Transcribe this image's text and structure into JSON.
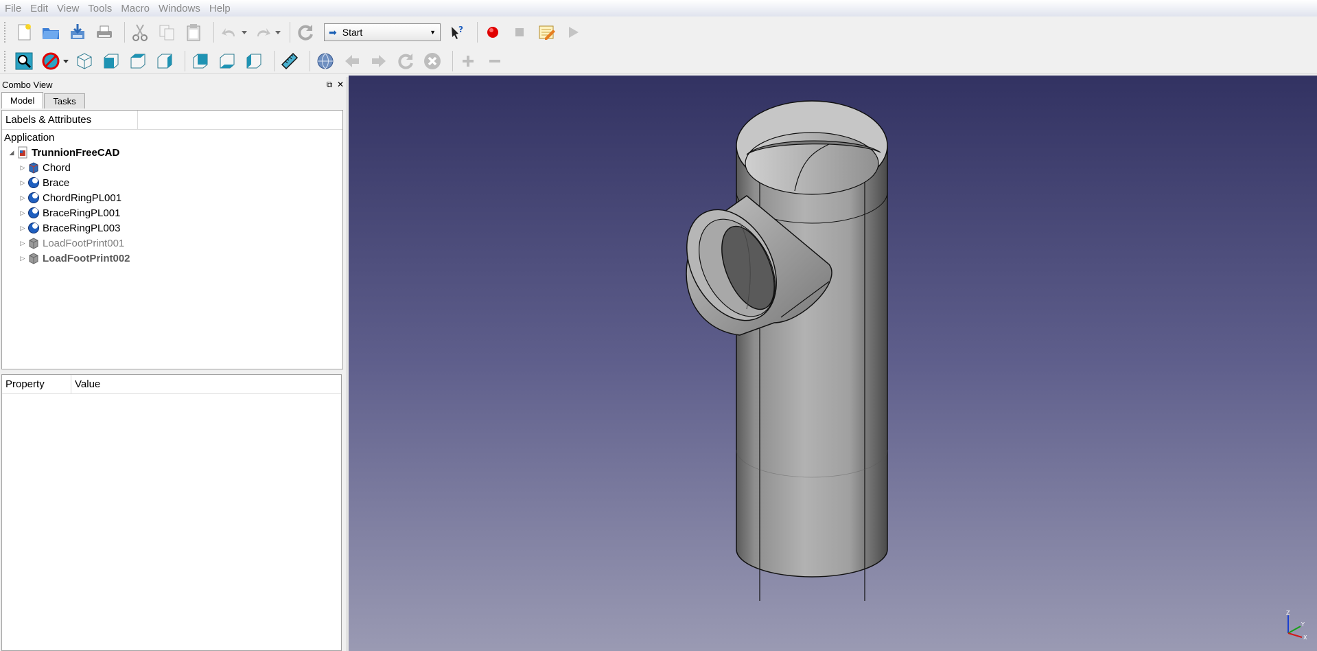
{
  "menubar": [
    "File",
    "Edit",
    "View",
    "Tools",
    "Macro",
    "Windows",
    "Help"
  ],
  "toolbar": {
    "workbench_selector": "Start",
    "icons1": [
      "new-document-icon",
      "open-folder-icon",
      "save-icon",
      "print-icon",
      "cut-icon",
      "copy-icon",
      "paste-icon",
      "undo-icon",
      "redo-icon",
      "refresh-icon",
      "whats-this-icon",
      "record-macro-icon",
      "stop-macro-icon",
      "edit-macro-icon",
      "run-macro-icon"
    ],
    "icons2": [
      "fit-all-icon",
      "draw-style-icon",
      "isometric-view-icon",
      "front-view-icon",
      "top-view-icon",
      "right-view-icon",
      "rear-view-icon",
      "bottom-view-icon",
      "left-view-icon",
      "measure-icon",
      "web-icon",
      "back-icon",
      "forward-icon",
      "reload-icon",
      "stop-icon",
      "zoom-in-icon",
      "zoom-out-icon"
    ]
  },
  "combo_view": {
    "title": "Combo View",
    "tabs": [
      "Model",
      "Tasks"
    ],
    "tree_header": "Labels & Attributes",
    "application_label": "Application",
    "root": "TrunnionFreeCAD",
    "items": [
      {
        "label": "Chord",
        "style": "normal",
        "icon": "part-solid-icon"
      },
      {
        "label": "Brace",
        "style": "normal",
        "icon": "sphere-icon"
      },
      {
        "label": "ChordRingPL001",
        "style": "normal",
        "icon": "sphere-icon"
      },
      {
        "label": "BraceRingPL001",
        "style": "normal",
        "icon": "sphere-icon"
      },
      {
        "label": "BraceRingPL003",
        "style": "normal",
        "icon": "sphere-icon"
      },
      {
        "label": "LoadFootPrint001",
        "style": "dim",
        "icon": "gray-solid-icon"
      },
      {
        "label": "LoadFootPrint002",
        "style": "bolddim",
        "icon": "gray-solid-icon"
      }
    ],
    "property_header": {
      "property": "Property",
      "value": "Value"
    }
  },
  "axis": {
    "z": "Z",
    "y": "Y",
    "x": "X"
  },
  "colors": {
    "viewport_top": "#323262",
    "viewport_bottom": "#9a9ab3",
    "record_red": "#e00000"
  }
}
